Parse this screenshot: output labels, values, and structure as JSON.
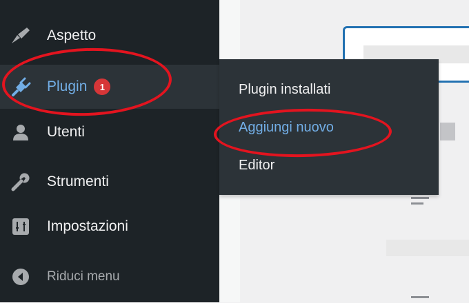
{
  "sidebar": {
    "items": [
      {
        "label": "Aspetto",
        "icon": "paint-brush-icon"
      },
      {
        "label": "Plugin",
        "icon": "plugin-icon",
        "badge": "1",
        "active": true
      },
      {
        "label": "Utenti",
        "icon": "users-icon"
      },
      {
        "label": "Strumenti",
        "icon": "wrench-icon"
      },
      {
        "label": "Impostazioni",
        "icon": "settings-icon"
      },
      {
        "label": "Riduci menu",
        "icon": "collapse-icon"
      }
    ]
  },
  "submenu": {
    "items": [
      {
        "label": "Plugin installati"
      },
      {
        "label": "Aggiungi nuovo",
        "current": true
      },
      {
        "label": "Editor"
      }
    ]
  },
  "colors": {
    "sidebar_bg": "#1d2327",
    "active_bg": "#2c3338",
    "accent": "#72aee6",
    "badge": "#d63638",
    "annotation": "#e3141f"
  }
}
